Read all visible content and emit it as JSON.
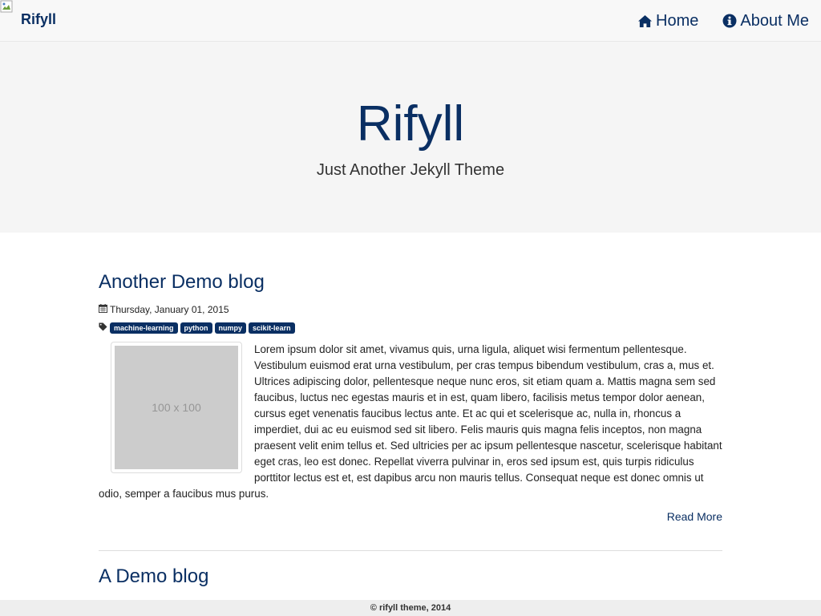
{
  "navbar": {
    "brand": "Rifyll",
    "links": [
      {
        "label": "Home",
        "icon": "home-icon"
      },
      {
        "label": "About Me",
        "icon": "info-circle-icon"
      }
    ]
  },
  "hero": {
    "title": "Rifyll",
    "subtitle": "Just Another Jekyll Theme"
  },
  "posts": [
    {
      "title": "Another Demo blog",
      "date": "Thursday, January 01, 2015",
      "tags": [
        "machine-learning",
        "python",
        "numpy",
        "scikit-learn"
      ],
      "thumbnail_label": "100 x 100",
      "excerpt": "Lorem ipsum dolor sit amet, vivamus quis, urna ligula, aliquet wisi fermentum pellentesque. Vestibulum euismod erat urna vestibulum, per cras tempus bibendum vestibulum, cras a, mus et. Ultrices adipiscing dolor, pellentesque neque nunc eros, sit etiam quam a. Mattis magna sem sed faucibus, luctus nec egestas mauris et in est, quam libero, facilisis metus tempor dolor aenean, cursus eget venenatis faucibus lectus ante. Et ac qui et scelerisque ac, nulla in, rhoncus a imperdiet, dui ac eu euismod sed sit libero. Felis mauris quis magna felis inceptos, non magna praesent velit enim tellus et. Sed ultricies per ac ipsum pellentesque nascetur, scelerisque habitant eget cras, leo est donec. Repellat viverra pulvinar in, eros sed ipsum est, quis turpis ridiculus porttitor lectus est et, est dapibus arcu non mauris tellus. Consequat neque est donec omnis ut odio, semper a faucibus mus purus.",
      "read_more": "Read More"
    },
    {
      "title": "A Demo blog"
    }
  ],
  "footer": {
    "text": "© rifyll theme, 2014"
  },
  "colors": {
    "primary": "#0a2f63",
    "hero_bg": "#f5f5f5",
    "navbar_bg": "#f8f8f8"
  }
}
